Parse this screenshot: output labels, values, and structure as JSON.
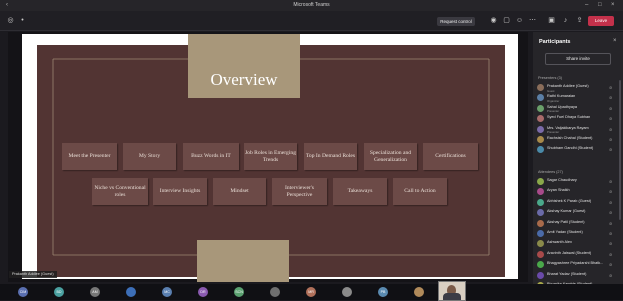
{
  "window": {
    "title": "Microsoft Teams"
  },
  "toolbar": {
    "request_control": "Request control",
    "leave": "Leave"
  },
  "slide": {
    "title": "Overview",
    "tiles": [
      "Meet the Presenter",
      "My Story",
      "Buzz Words in IT",
      "Job Roles in Emerging Trends",
      "Top In Demand Roles",
      "Specialization and Generalization",
      "Certifications",
      "Niche vs Conventional roles",
      "Interview Insights",
      "Mindset",
      "Interviewer's Perspective",
      "Takeaways",
      "Call to Action"
    ],
    "colors": {
      "background": "#523433",
      "tile": "#6c4a47",
      "accent": "#a8977a"
    }
  },
  "presenter_tag": "Prakanth Addlee (Guest)",
  "participants_panel": {
    "title": "Participants",
    "share_invite": "Share invite",
    "presenters_label": "Presenters (3)",
    "attendees_label": "Attendees (27)",
    "presenters": [
      {
        "name": "Prakanth Addlee (Guest)",
        "sub": "Guest",
        "color": "#8a6d5a"
      },
      {
        "name": "Rathi Kumaraian",
        "sub": "Organizer",
        "color": "#5b7fa6"
      },
      {
        "name": "Sahal Upadhyaya",
        "sub": "Presenter",
        "color": "#6a9f6a"
      },
      {
        "name": "Syed Fuel Dhaya Subhan",
        "sub": "",
        "color": "#a86a6a"
      },
      {
        "name": "Mrs. Vaijakikarya Rayam",
        "sub": "Presenter",
        "color": "#7a6aa8"
      },
      {
        "name": "Rachsish Chahal (Student)",
        "sub": "",
        "color": "#a88a4a"
      },
      {
        "name": "Shubham Gandhi (Student)",
        "sub": "",
        "color": "#4a8aa8"
      }
    ],
    "attendees": [
      {
        "name": "Sagar Chaudhary",
        "sub": "",
        "color": "#8aa84a"
      },
      {
        "name": "Aryan Shaikh",
        "sub": "",
        "color": "#a84a8a"
      },
      {
        "name": "Abhishek K Parab (Guest)",
        "sub": "",
        "color": "#4aa88a"
      },
      {
        "name": "Akshay Kumar (Guest)",
        "sub": "",
        "color": "#6a6aa8"
      },
      {
        "name": "Akshay Patil (Student)",
        "sub": "",
        "color": "#a86a4a"
      },
      {
        "name": "Amit Yadav (Student)",
        "sub": "",
        "color": "#4a6aa8"
      },
      {
        "name": "Ashwanth Alex",
        "sub": "",
        "color": "#8a8a4a"
      },
      {
        "name": "Aravinth Jaiswal (Student)",
        "sub": "",
        "color": "#a84a4a"
      },
      {
        "name": "Bhagyashree Priyadarshi Bhatk...",
        "sub": "",
        "color": "#4aa84a"
      },
      {
        "name": "Bharat Yadav (Student)",
        "sub": "",
        "color": "#6a4aa8"
      },
      {
        "name": "Bhumika Kamble (Student)",
        "sub": "",
        "color": "#a8a84a"
      }
    ]
  },
  "taskbar": {
    "apps": [
      {
        "label": "CIM",
        "color": "#5a6fb0"
      },
      {
        "label": "BD",
        "color": "#4aa0a0"
      },
      {
        "label": "AM",
        "color": "#777777"
      },
      {
        "label": "",
        "color": "#3d6fb8"
      },
      {
        "label": "MC",
        "color": "#5a7fb0"
      },
      {
        "label": "DR",
        "color": "#8a5ab0"
      },
      {
        "label": "SCN",
        "color": "#5aa06f"
      },
      {
        "label": "",
        "color": "#6f6f6f"
      },
      {
        "label": "MR",
        "color": "#b0705a"
      },
      {
        "label": "",
        "color": "#8a8a8a"
      },
      {
        "label": "PB",
        "color": "#5a8ab0"
      },
      {
        "label": "",
        "color": "#b08a5a"
      }
    ]
  }
}
